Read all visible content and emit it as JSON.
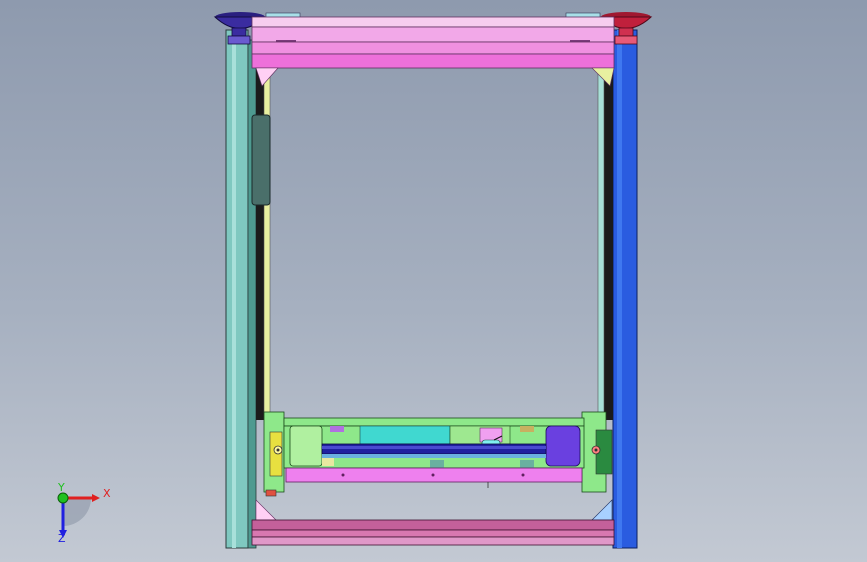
{
  "viewport": {
    "background_top": "#8e9aae",
    "background_bottom": "#c3c9d3"
  },
  "triad": {
    "x_label": "X",
    "y_label": "Y",
    "z_label": "Z",
    "x_color": "#e02020",
    "y_color": "#20c020",
    "z_color": "#2020e0"
  },
  "model": {
    "left_column_color": "#7fc8c0",
    "right_column_color": "#2a5ce0",
    "top_beam_color": "#f2a8e8",
    "bottom_beam_color": "#c4609a",
    "carriage_color": "#8ee88a",
    "tray_color": "#ee80ee",
    "shaft_color": "#2020a0",
    "left_foot_color": "#2a1f80",
    "right_foot_color": "#c0203c"
  }
}
